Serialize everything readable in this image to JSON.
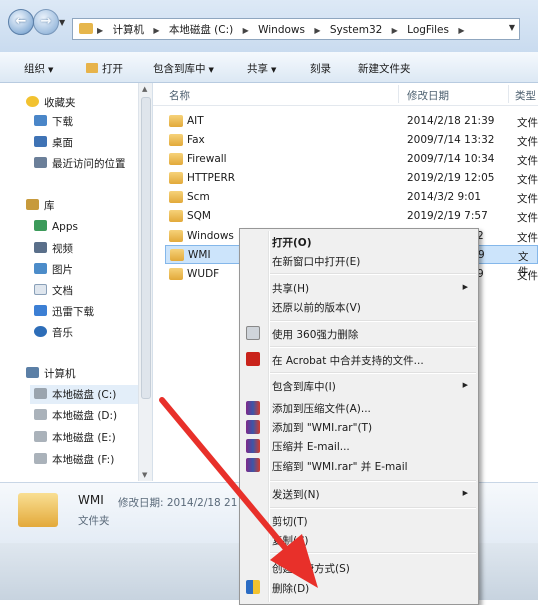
{
  "address": {
    "crumbs": [
      "计算机",
      "本地磁盘 (C:)",
      "Windows",
      "System32",
      "LogFiles"
    ]
  },
  "toolbar": {
    "organize": "组织",
    "open": "打开",
    "include_in_library": "包含到库中",
    "share": "共享",
    "burn": "刻录",
    "new_folder": "新建文件夹"
  },
  "nav": {
    "favorites": "收藏夹",
    "downloads": "下载",
    "desktop": "桌面",
    "recent": "最近访问的位置",
    "libraries": "库",
    "apps": "Apps",
    "videos": "视频",
    "pictures": "图片",
    "documents": "文档",
    "thunder": "迅雷下载",
    "music": "音乐",
    "computer": "计算机",
    "drive_c": "本地磁盘 (C:)",
    "drive_d": "本地磁盘 (D:)",
    "drive_e": "本地磁盘 (E:)",
    "drive_f": "本地磁盘 (F:)"
  },
  "columns": {
    "name": "名称",
    "modified": "修改日期",
    "type": "类型"
  },
  "files": [
    {
      "name": "AIT",
      "date": "2014/2/18 21:39",
      "type": "文件"
    },
    {
      "name": "Fax",
      "date": "2009/7/14 13:32",
      "type": "文件"
    },
    {
      "name": "Firewall",
      "date": "2009/7/14 10:34",
      "type": "文件"
    },
    {
      "name": "HTTPERR",
      "date": "2019/2/19 12:05",
      "type": "文件"
    },
    {
      "name": "Scm",
      "date": "2014/3/2 9:01",
      "type": "文件"
    },
    {
      "name": "SQM",
      "date": "2019/2/19 7:57",
      "type": "文件"
    },
    {
      "name": "Windows",
      "date": "2",
      "type": "文件"
    },
    {
      "name": "WMI",
      "date": "9",
      "type": "文件"
    },
    {
      "name": "WUDF",
      "date": "9",
      "type": "文件"
    }
  ],
  "details": {
    "name": "WMI",
    "meta": "修改日期: 2014/2/18 21",
    "kind": "文件夹"
  },
  "menu": {
    "open": "打开(O)",
    "open_new_window": "在新窗口中打开(E)",
    "share": "共享(H)",
    "restore": "还原以前的版本(V)",
    "delete360": "使用 360强力删除",
    "acrobat": "在 Acrobat 中合并支持的文件...",
    "include_library": "包含到库中(I)",
    "add_archive": "添加到压缩文件(A)...",
    "add_wmi_rar": "添加到 \"WMI.rar\"(T)",
    "compress_email": "压缩并 E-mail...",
    "compress_wmi_email": "压缩到 \"WMI.rar\" 并 E-mail",
    "send_to": "发送到(N)",
    "cut": "剪切(T)",
    "copy": "复制(C)",
    "shortcut": "创建快捷方式(S)",
    "delete": "删除(D)"
  },
  "colors": {
    "arrow": "#e8302a",
    "selection": "#cce4fb",
    "folder": "#e8b44c"
  }
}
